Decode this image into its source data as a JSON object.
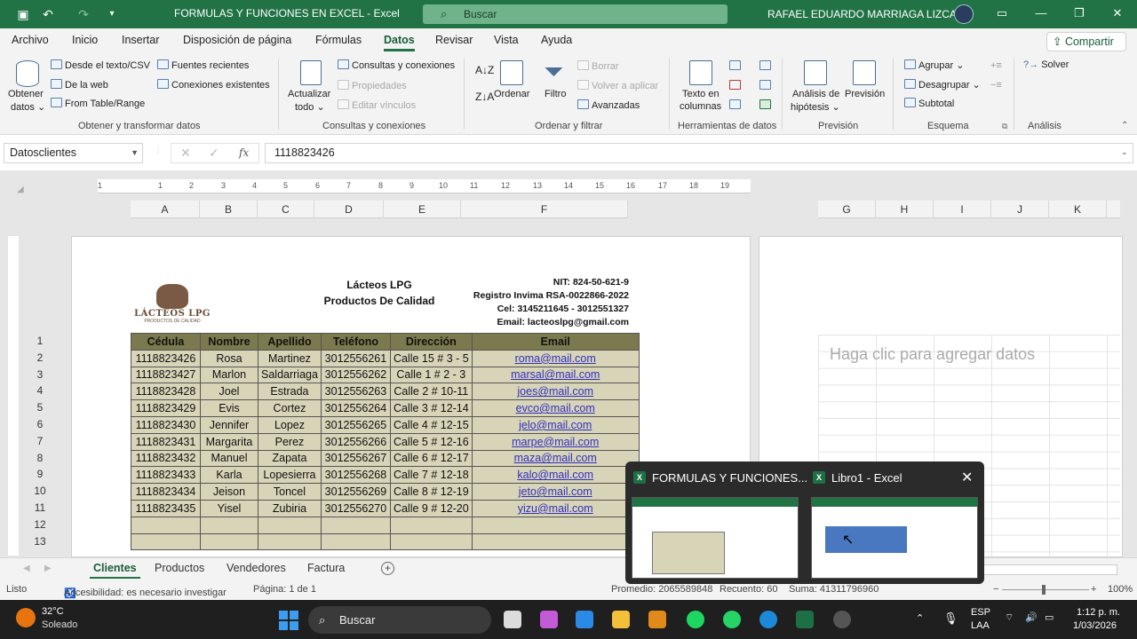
{
  "titlebar": {
    "title": "FORMULAS Y FUNCIONES EN EXCEL  -  Excel",
    "search_placeholder": "Buscar",
    "user": "RAFAEL EDUARDO MARRIAGA LIZCANO"
  },
  "menu": {
    "tabs": [
      "Archivo",
      "Inicio",
      "Insertar",
      "Disposición de página",
      "Fórmulas",
      "Datos",
      "Revisar",
      "Vista",
      "Ayuda"
    ],
    "active": "Datos",
    "share": "Compartir"
  },
  "ribbon": {
    "get_data": "Obtener",
    "get_data2": "datos ⌄",
    "from_text": "Desde el texto/CSV",
    "from_web": "De la web",
    "from_table": "From Table/Range",
    "recent_sources": "Fuentes recientes",
    "existing_connections": "Conexiones existentes",
    "group_get": "Obtener y transformar datos",
    "refresh_all": "Actualizar",
    "refresh_all2": "todo ⌄",
    "queries": "Consultas y conexiones",
    "properties": "Propiedades",
    "edit_links": "Editar vínculos",
    "group_queries": "Consultas y conexiones",
    "sort": "Ordenar",
    "filter": "Filtro",
    "clear": "Borrar",
    "reapply": "Volver a aplicar",
    "advanced": "Avanzadas",
    "group_sort": "Ordenar y filtrar",
    "text_to_columns": "Texto en",
    "text_to_columns2": "columnas",
    "group_tools": "Herramientas de datos",
    "whatif": "Análisis de",
    "whatif2": "hipótesis ⌄",
    "forecast": "Previsión",
    "group_forecast": "Previsión",
    "group_btn": "Agrupar",
    "ungroup": "Desagrupar",
    "subtotal": "Subtotal",
    "group_outline": "Esquema",
    "solver": "Solver",
    "group_analysis": "Análisis"
  },
  "formula_bar": {
    "name_box": "Datosclientes",
    "formula": "1118823426"
  },
  "ruler": [
    "1",
    "1",
    "2",
    "3",
    "4",
    "5",
    "6",
    "7",
    "8",
    "9",
    "10",
    "11",
    "12",
    "13",
    "14",
    "15",
    "16",
    "17",
    "18",
    "19"
  ],
  "columns_left": [
    "A",
    "B",
    "C",
    "D",
    "E",
    "F"
  ],
  "columns_right": [
    "G",
    "H",
    "I",
    "J",
    "K"
  ],
  "row_numbers": [
    "1",
    "2",
    "3",
    "4",
    "5",
    "6",
    "7",
    "8",
    "9",
    "10",
    "11",
    "12",
    "13"
  ],
  "sheet_header": {
    "logo_title": "LÁCTEOS LPG",
    "logo_sub": "PRODUCTOS DE CALIDAD",
    "company": "Lácteos LPG",
    "tagline": "Productos De Calidad",
    "nit": "NIT: 824-50-621-9",
    "registro": "Registro Invima RSA-0022866-2022",
    "cel": "Cel: 3145211645 - 3012551327",
    "email": "Email: lacteoslpg@gmail.com"
  },
  "table": {
    "headers": [
      "Cédula",
      "Nombre",
      "Apellido",
      "Teléfono",
      "Dirección",
      "Email"
    ],
    "rows": [
      [
        "1118823426",
        "Rosa",
        "Martinez",
        "3012556261",
        "Calle 15 # 3 - 5",
        "roma@mail.com"
      ],
      [
        "1118823427",
        "Marlon",
        "Saldarriaga",
        "3012556262",
        "Calle 1 # 2 - 3",
        "marsal@mail.com"
      ],
      [
        "1118823428",
        "Joel",
        "Estrada",
        "3012556263",
        "Calle 2 # 10-11",
        "joes@mail.com"
      ],
      [
        "1118823429",
        "Evis",
        "Cortez",
        "3012556264",
        "Calle 3 # 12-14",
        "evco@mail.com"
      ],
      [
        "1118823430",
        "Jennifer",
        "Lopez",
        "3012556265",
        "Calle 4 # 12-15",
        "jelo@mail.com"
      ],
      [
        "1118823431",
        "Margarita",
        "Perez",
        "3012556266",
        "Calle 5 # 12-16",
        "marpe@mail.com"
      ],
      [
        "1118823432",
        "Manuel",
        "Zapata",
        "3012556267",
        "Calle 6 # 12-17",
        "maza@mail.com"
      ],
      [
        "1118823433",
        "Karla",
        "Lopesierra",
        "3012556268",
        "Calle 7 # 12-18",
        "kalo@mail.com"
      ],
      [
        "1118823434",
        "Jeison",
        "Toncel",
        "3012556269",
        "Calle 8 # 12-19",
        "jeto@mail.com"
      ],
      [
        "1118823435",
        "Yisel",
        "Zubiria",
        "3012556270",
        "Calle 9 # 12-20",
        "yizu@mail.com"
      ],
      [
        "",
        "",
        "",
        "",
        "",
        ""
      ],
      [
        "",
        "",
        "",
        "",
        "",
        ""
      ]
    ]
  },
  "page2_placeholder": "Haga clic para agregar datos",
  "sheet_tabs": [
    "Clientes",
    "Productos",
    "Vendedores",
    "Factura"
  ],
  "active_sheet": "Clientes",
  "statusbar": {
    "ready": "Listo",
    "accessibility": "Accesibilidad: es necesario investigar",
    "page": "Página: 1 de 1",
    "average": "Promedio: 2065589848",
    "count": "Recuento: 60",
    "sum": "Suma: 41311796960",
    "zoom": "100%"
  },
  "preview": {
    "item1": "FORMULAS Y FUNCIONES...",
    "item2": "Libro1 - Excel"
  },
  "taskbar": {
    "temp": "32°C",
    "weather": "Soleado",
    "search": "Buscar",
    "lang1": "ESP",
    "lang2": "LAA",
    "time": "1:12 p. m.",
    "date": "1/03/2026"
  },
  "colors": {
    "excel_green": "#217346",
    "header_fill": "#7b7a4e",
    "table_fill": "#d8d4b8"
  }
}
